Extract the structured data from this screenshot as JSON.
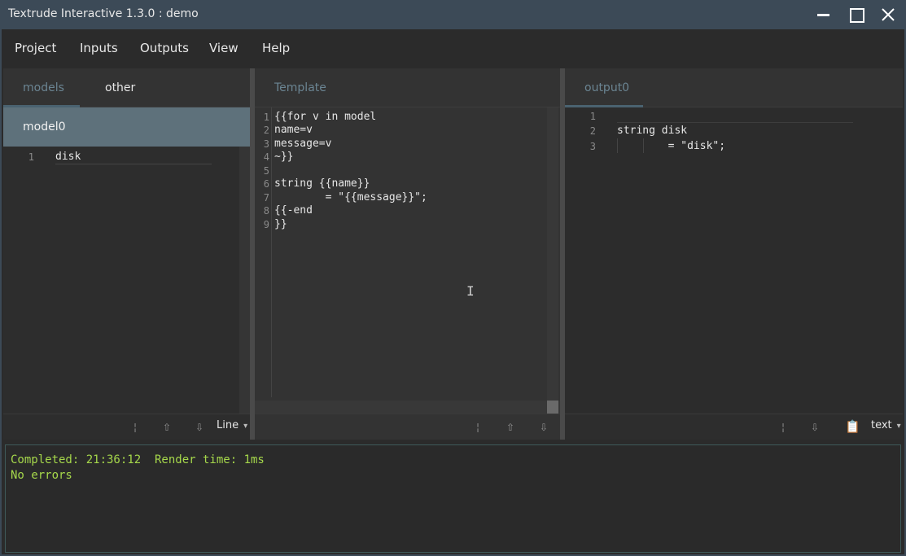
{
  "window": {
    "title": "Textrude Interactive 1.3.0 : demo"
  },
  "menu": [
    "Project",
    "Inputs",
    "Outputs",
    "View",
    "Help"
  ],
  "left_panel": {
    "tabs": [
      {
        "label": "models"
      },
      {
        "label": "other"
      }
    ],
    "model_item": "model0",
    "lines": [
      {
        "n": "1",
        "text": "disk"
      }
    ],
    "status": {
      "mode": "Line"
    }
  },
  "template_panel": {
    "tabs": [
      {
        "label": "Template"
      }
    ],
    "lines": [
      {
        "n": "1",
        "text": "{{for v in model"
      },
      {
        "n": "2",
        "text": "name=v"
      },
      {
        "n": "3",
        "text": "message=v"
      },
      {
        "n": "4",
        "text": "~}}"
      },
      {
        "n": "5",
        "text": ""
      },
      {
        "n": "6",
        "text": "string {{name}}"
      },
      {
        "n": "7",
        "text": "        = \"{{message}}\";"
      },
      {
        "n": "8",
        "text": "{{-end"
      },
      {
        "n": "9",
        "text": "}}"
      }
    ]
  },
  "output_panel": {
    "tabs": [
      {
        "label": "output0"
      }
    ],
    "lines": [
      {
        "n": "1",
        "text": ""
      },
      {
        "n": "2",
        "text": "string disk"
      },
      {
        "n": "3",
        "text": "        = \"disk\";"
      }
    ],
    "status": {
      "format": "text"
    }
  },
  "console": {
    "status_line": "Completed: 21:36:12  Render time: 1ms",
    "errors_line": "No errors"
  },
  "colors": {
    "titlebar": "#3c4a57",
    "accent": "#5e717b",
    "console_text": "#a6d84b"
  }
}
